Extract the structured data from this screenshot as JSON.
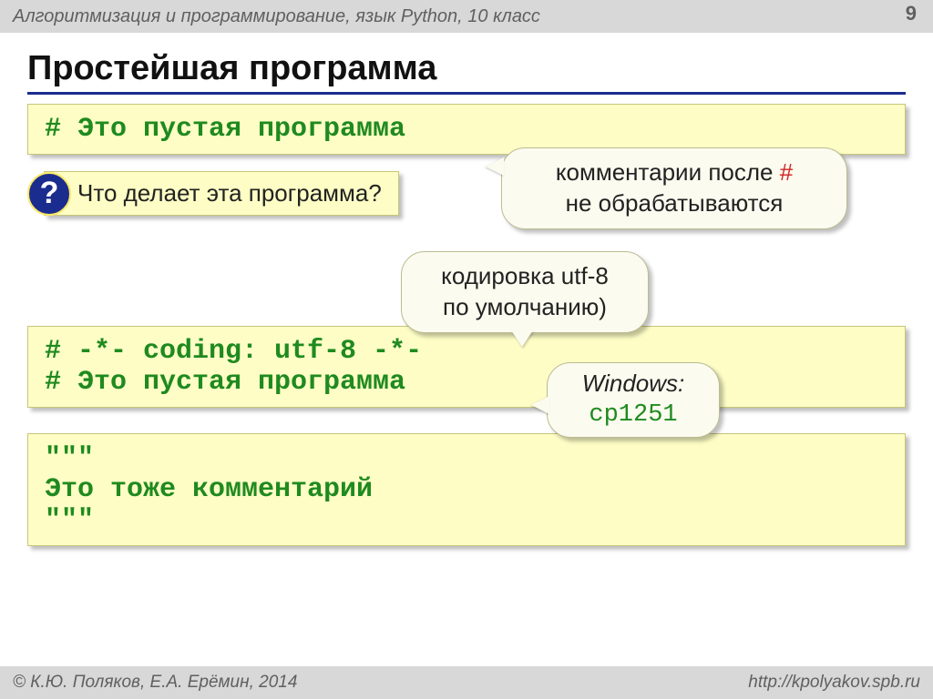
{
  "header": {
    "subject": "Алгоритмизация и программирование, язык Python, 10 класс",
    "page_number": "9"
  },
  "title": "Простейшая программа",
  "codebox1": {
    "line1": "# Это пустая программа"
  },
  "question": {
    "mark": "?",
    "text": "Что делает эта программа?"
  },
  "callout_comments": {
    "line1_pre": "комментарии после ",
    "line1_hash": "#",
    "line2": "не обрабатываются"
  },
  "callout_utf": {
    "line1": "кодировка utf-8",
    "line2": "по умолчанию)"
  },
  "codebox2": {
    "line1": "# -*- coding: utf-8 -*-",
    "line2": "# Это пустая программа"
  },
  "callout_win": {
    "label": "Windows:",
    "value": "cp1251"
  },
  "codebox3": {
    "line1": "\"\"\"",
    "line2": "Это тоже комментарий",
    "line3": "\"\"\""
  },
  "footer": {
    "authors": "© К.Ю. Поляков, Е.А. Ерёмин, 2014",
    "url": "http://kpolyakov.spb.ru"
  }
}
